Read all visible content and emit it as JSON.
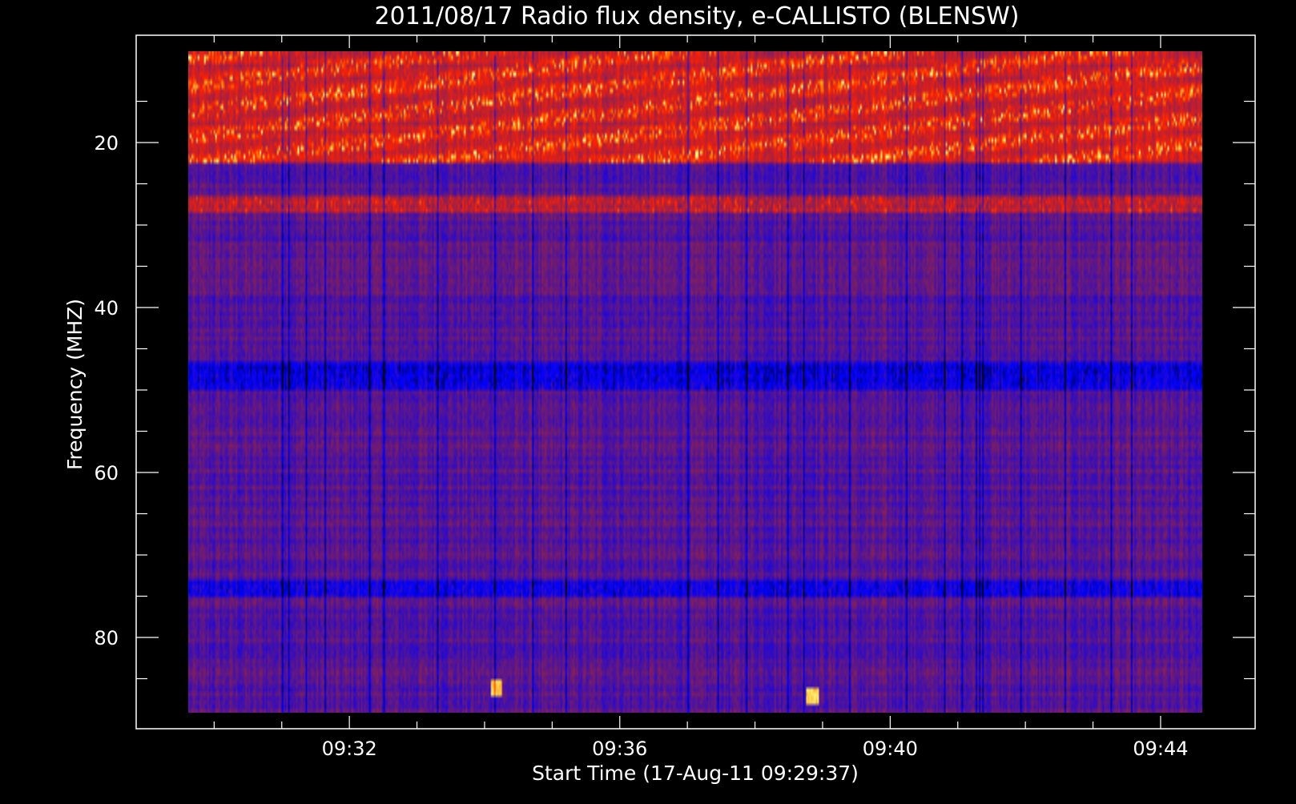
{
  "chart_data": {
    "type": "heatmap",
    "title": "2011/08/17  Radio flux density, e-CALLISTO (BLENSW)",
    "xlabel": "Start Time (17-Aug-11 09:29:37)",
    "ylabel": "Frequency (MHZ)",
    "x_range_minutes": [
      9.5,
      9.5
    ],
    "x_axis": {
      "min": "09:29:37",
      "max": "09:44:37",
      "tick_labels": [
        "09:32",
        "09:36",
        "09:40",
        "09:44"
      ],
      "tick_minutes": [
        32,
        36,
        40,
        44
      ]
    },
    "y_axis": {
      "range": [
        9,
        91
      ],
      "inverted": true,
      "tick_labels": [
        "20",
        "40",
        "60",
        "80"
      ],
      "tick_values": [
        20,
        40,
        60,
        80
      ]
    },
    "data_extent": {
      "time": [
        "09:29:37",
        "09:44:37"
      ],
      "frequency_mhz": [
        10,
        89
      ]
    },
    "colormap": [
      "#000000",
      "#0000ff",
      "#7f1f5f",
      "#ff2000",
      "#ff8000",
      "#ffff80"
    ],
    "grid": false,
    "legend": "none",
    "features": [
      {
        "label": "intense emission band",
        "frequency_mhz": [
          10,
          23
        ]
      },
      {
        "label": "emission band",
        "frequency_mhz": [
          27,
          29
        ]
      },
      {
        "label": "dark band",
        "frequency_mhz": [
          47,
          50
        ]
      },
      {
        "label": "dark band",
        "frequency_mhz": [
          73,
          75
        ]
      },
      {
        "label": "burst",
        "time": "09:34:10",
        "frequency_mhz": [
          85,
          87
        ]
      },
      {
        "label": "burst",
        "time": "09:38:50",
        "frequency_mhz": [
          86,
          88
        ]
      }
    ]
  }
}
